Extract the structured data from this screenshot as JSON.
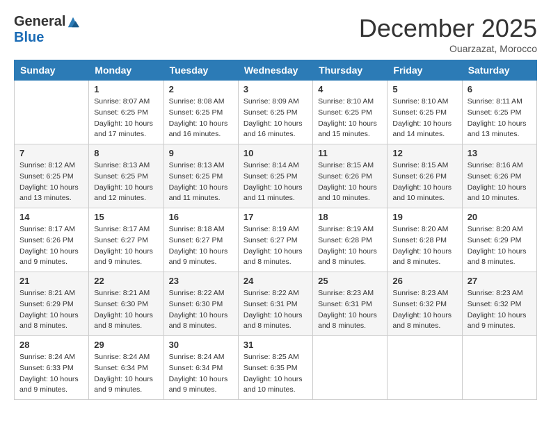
{
  "header": {
    "logo": {
      "general": "General",
      "blue": "Blue"
    },
    "title": "December 2025",
    "subtitle": "Ouarzazat, Morocco"
  },
  "days_of_week": [
    "Sunday",
    "Monday",
    "Tuesday",
    "Wednesday",
    "Thursday",
    "Friday",
    "Saturday"
  ],
  "weeks": [
    [
      null,
      {
        "day": 1,
        "sunrise": "8:07 AM",
        "sunset": "6:25 PM",
        "daylight": "10 hours and 17 minutes."
      },
      {
        "day": 2,
        "sunrise": "8:08 AM",
        "sunset": "6:25 PM",
        "daylight": "10 hours and 16 minutes."
      },
      {
        "day": 3,
        "sunrise": "8:09 AM",
        "sunset": "6:25 PM",
        "daylight": "10 hours and 16 minutes."
      },
      {
        "day": 4,
        "sunrise": "8:10 AM",
        "sunset": "6:25 PM",
        "daylight": "10 hours and 15 minutes."
      },
      {
        "day": 5,
        "sunrise": "8:10 AM",
        "sunset": "6:25 PM",
        "daylight": "10 hours and 14 minutes."
      },
      {
        "day": 6,
        "sunrise": "8:11 AM",
        "sunset": "6:25 PM",
        "daylight": "10 hours and 13 minutes."
      }
    ],
    [
      {
        "day": 7,
        "sunrise": "8:12 AM",
        "sunset": "6:25 PM",
        "daylight": "10 hours and 13 minutes."
      },
      {
        "day": 8,
        "sunrise": "8:13 AM",
        "sunset": "6:25 PM",
        "daylight": "10 hours and 12 minutes."
      },
      {
        "day": 9,
        "sunrise": "8:13 AM",
        "sunset": "6:25 PM",
        "daylight": "10 hours and 11 minutes."
      },
      {
        "day": 10,
        "sunrise": "8:14 AM",
        "sunset": "6:25 PM",
        "daylight": "10 hours and 11 minutes."
      },
      {
        "day": 11,
        "sunrise": "8:15 AM",
        "sunset": "6:26 PM",
        "daylight": "10 hours and 10 minutes."
      },
      {
        "day": 12,
        "sunrise": "8:15 AM",
        "sunset": "6:26 PM",
        "daylight": "10 hours and 10 minutes."
      },
      {
        "day": 13,
        "sunrise": "8:16 AM",
        "sunset": "6:26 PM",
        "daylight": "10 hours and 10 minutes."
      }
    ],
    [
      {
        "day": 14,
        "sunrise": "8:17 AM",
        "sunset": "6:26 PM",
        "daylight": "10 hours and 9 minutes."
      },
      {
        "day": 15,
        "sunrise": "8:17 AM",
        "sunset": "6:27 PM",
        "daylight": "10 hours and 9 minutes."
      },
      {
        "day": 16,
        "sunrise": "8:18 AM",
        "sunset": "6:27 PM",
        "daylight": "10 hours and 9 minutes."
      },
      {
        "day": 17,
        "sunrise": "8:19 AM",
        "sunset": "6:27 PM",
        "daylight": "10 hours and 8 minutes."
      },
      {
        "day": 18,
        "sunrise": "8:19 AM",
        "sunset": "6:28 PM",
        "daylight": "10 hours and 8 minutes."
      },
      {
        "day": 19,
        "sunrise": "8:20 AM",
        "sunset": "6:28 PM",
        "daylight": "10 hours and 8 minutes."
      },
      {
        "day": 20,
        "sunrise": "8:20 AM",
        "sunset": "6:29 PM",
        "daylight": "10 hours and 8 minutes."
      }
    ],
    [
      {
        "day": 21,
        "sunrise": "8:21 AM",
        "sunset": "6:29 PM",
        "daylight": "10 hours and 8 minutes."
      },
      {
        "day": 22,
        "sunrise": "8:21 AM",
        "sunset": "6:30 PM",
        "daylight": "10 hours and 8 minutes."
      },
      {
        "day": 23,
        "sunrise": "8:22 AM",
        "sunset": "6:30 PM",
        "daylight": "10 hours and 8 minutes."
      },
      {
        "day": 24,
        "sunrise": "8:22 AM",
        "sunset": "6:31 PM",
        "daylight": "10 hours and 8 minutes."
      },
      {
        "day": 25,
        "sunrise": "8:23 AM",
        "sunset": "6:31 PM",
        "daylight": "10 hours and 8 minutes."
      },
      {
        "day": 26,
        "sunrise": "8:23 AM",
        "sunset": "6:32 PM",
        "daylight": "10 hours and 8 minutes."
      },
      {
        "day": 27,
        "sunrise": "8:23 AM",
        "sunset": "6:32 PM",
        "daylight": "10 hours and 9 minutes."
      }
    ],
    [
      {
        "day": 28,
        "sunrise": "8:24 AM",
        "sunset": "6:33 PM",
        "daylight": "10 hours and 9 minutes."
      },
      {
        "day": 29,
        "sunrise": "8:24 AM",
        "sunset": "6:34 PM",
        "daylight": "10 hours and 9 minutes."
      },
      {
        "day": 30,
        "sunrise": "8:24 AM",
        "sunset": "6:34 PM",
        "daylight": "10 hours and 9 minutes."
      },
      {
        "day": 31,
        "sunrise": "8:25 AM",
        "sunset": "6:35 PM",
        "daylight": "10 hours and 10 minutes."
      },
      null,
      null,
      null
    ]
  ]
}
